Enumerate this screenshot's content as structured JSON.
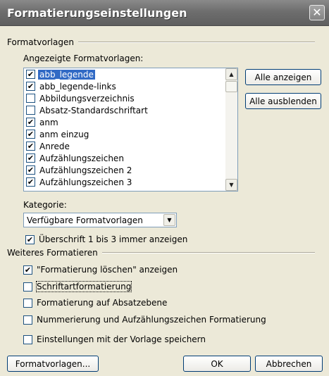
{
  "window": {
    "title": "Formatierungseinstellungen",
    "close_symbol": "✕"
  },
  "formatvorlagen": {
    "group_label": "Formatvorlagen",
    "shown_label": "Angezeigte Formatvorlagen:",
    "items": [
      {
        "label": "abb_legende",
        "checked": true,
        "selected": true
      },
      {
        "label": "abb_legende-links",
        "checked": true,
        "selected": false
      },
      {
        "label": "Abbildungsverzeichnis",
        "checked": false,
        "selected": false
      },
      {
        "label": "Absatz-Standardschriftart",
        "checked": false,
        "selected": false
      },
      {
        "label": "anm",
        "checked": true,
        "selected": false
      },
      {
        "label": "anm einzug",
        "checked": true,
        "selected": false
      },
      {
        "label": "Anrede",
        "checked": true,
        "selected": false
      },
      {
        "label": "Aufzählungszeichen",
        "checked": true,
        "selected": false
      },
      {
        "label": "Aufzählungszeichen 2",
        "checked": true,
        "selected": false
      },
      {
        "label": "Aufzählungszeichen 3",
        "checked": true,
        "selected": false
      }
    ],
    "btn_show_all": "Alle anzeigen",
    "btn_hide_all": "Alle ausblenden",
    "kategorie_label": "Kategorie:",
    "kategorie_value": "Verfügbare Formatvorlagen",
    "heading_check_label": "Überschrift 1 bis 3 immer anzeigen",
    "heading_check_checked": true
  },
  "weiteres": {
    "group_label": "Weiteres Formatieren",
    "options": [
      {
        "label": "\"Formatierung löschen\" anzeigen",
        "checked": true
      },
      {
        "label": "Schriftartformatierung",
        "checked": false
      },
      {
        "label": "Formatierung auf Absatzebene",
        "checked": false
      },
      {
        "label": "Nummerierung und Aufzählungszeichen Formatierung",
        "checked": false
      }
    ]
  },
  "save_with_template": {
    "label": "Einstellungen mit der Vorlage speichern",
    "checked": false
  },
  "footer": {
    "btn_formatvorlagen": "Formatvorlagen...",
    "btn_ok": "OK",
    "btn_cancel": "Abbrechen"
  }
}
